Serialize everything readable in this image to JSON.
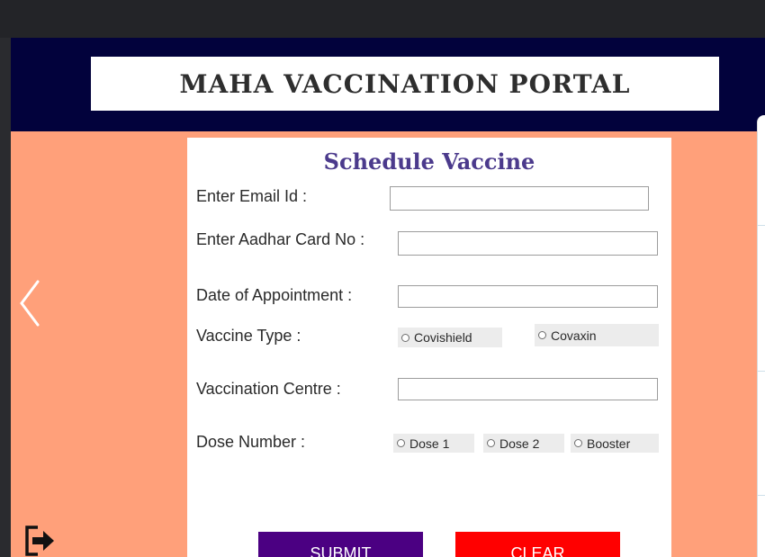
{
  "app": {
    "title": "MAHA VACCINATION PORTAL",
    "colors": {
      "header": "#02023c",
      "background": "#ffa07a",
      "submit": "#4b0082",
      "clear": "#ff0000",
      "form_title": "#4b3a8c"
    }
  },
  "form": {
    "title": "Schedule Vaccine",
    "email_label": "Enter Email Id :",
    "email_value": "",
    "aadhar_label": "Enter Aadhar Card No :",
    "aadhar_value": "",
    "date_label": "Date of Appointment :",
    "date_value": "",
    "vaccine_type_label": "Vaccine Type :",
    "vaccine_options": [
      "Covishield",
      "Covaxin"
    ],
    "centre_label": "Vaccination Centre :",
    "centre_value": "",
    "dose_label": "Dose Number  :",
    "dose_options": [
      "Dose 1",
      "Dose 2",
      "Booster"
    ],
    "submit_label": "SUBMIT",
    "clear_label": "CLEAR"
  },
  "icons": {
    "back": "chevron-left-icon",
    "exit": "exit-icon"
  }
}
